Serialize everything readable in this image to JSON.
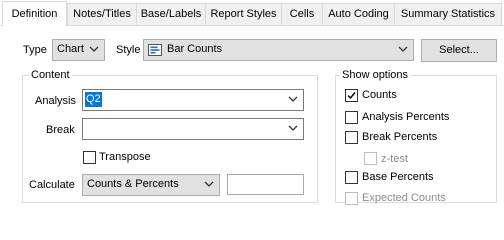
{
  "tabs": [
    {
      "label": "Definition",
      "active": true
    },
    {
      "label": "Notes/Titles",
      "active": false
    },
    {
      "label": "Base/Labels",
      "active": false
    },
    {
      "label": "Report Styles",
      "active": false
    },
    {
      "label": "Cells",
      "active": false
    },
    {
      "label": "Auto Coding",
      "active": false
    },
    {
      "label": "Summary Statistics",
      "active": false
    }
  ],
  "type": {
    "label": "Type",
    "value": "Chart"
  },
  "style": {
    "label": "Style",
    "value": "Bar Counts",
    "icon": "bar-chart-icon",
    "button_label": "Select..."
  },
  "content": {
    "title": "Content",
    "analysis": {
      "label": "Analysis",
      "value": "Q2"
    },
    "break": {
      "label": "Break",
      "value": ""
    },
    "transpose": {
      "label": "Transpose",
      "checked": false
    },
    "calculate": {
      "label": "Calculate",
      "value": "Counts & Percents",
      "extra_value": ""
    }
  },
  "show_options": {
    "title": "Show options",
    "items": [
      {
        "label": "Counts",
        "checked": true,
        "enabled": true
      },
      {
        "label": "Analysis Percents",
        "checked": false,
        "enabled": true
      },
      {
        "label": "Break Percents",
        "checked": false,
        "enabled": true
      },
      {
        "label": "z-test",
        "checked": false,
        "enabled": false
      },
      {
        "label": "Base Percents",
        "checked": false,
        "enabled": true
      },
      {
        "label": "Expected Counts",
        "checked": false,
        "enabled": false
      }
    ]
  },
  "colors": {
    "selection": "#0078d7",
    "tab_inactive": "#f0f0f0",
    "button_face": "#e1e1e1"
  }
}
